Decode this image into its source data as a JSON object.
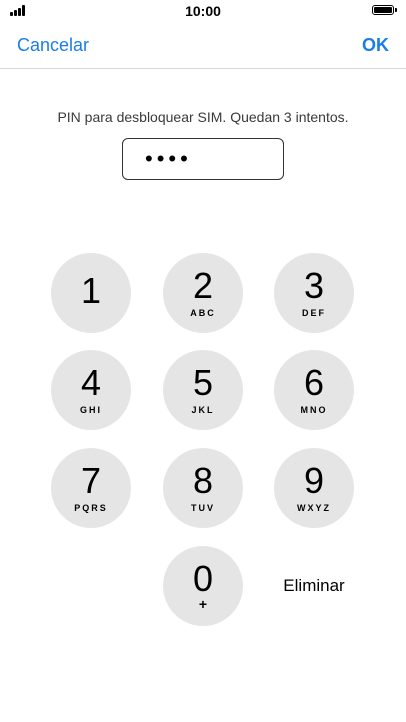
{
  "status_bar": {
    "time": "10:00"
  },
  "nav": {
    "cancel_label": "Cancelar",
    "ok_label": "OK"
  },
  "prompt": "PIN para desbloquear SIM. Quedan 3 intentos.",
  "pin_field": {
    "masked_value": "••••"
  },
  "keypad": {
    "keys": [
      {
        "digit": "1",
        "letters": ""
      },
      {
        "digit": "2",
        "letters": "ABC"
      },
      {
        "digit": "3",
        "letters": "DEF"
      },
      {
        "digit": "4",
        "letters": "GHI"
      },
      {
        "digit": "5",
        "letters": "JKL"
      },
      {
        "digit": "6",
        "letters": "MNO"
      },
      {
        "digit": "7",
        "letters": "PQRS"
      },
      {
        "digit": "8",
        "letters": "TUV"
      },
      {
        "digit": "9",
        "letters": "WXYZ"
      },
      {
        "digit": "0",
        "letters": "+"
      }
    ],
    "delete_label": "Eliminar"
  },
  "colors": {
    "accent": "#1a7ee8",
    "key_bg": "#e5e5e5"
  }
}
